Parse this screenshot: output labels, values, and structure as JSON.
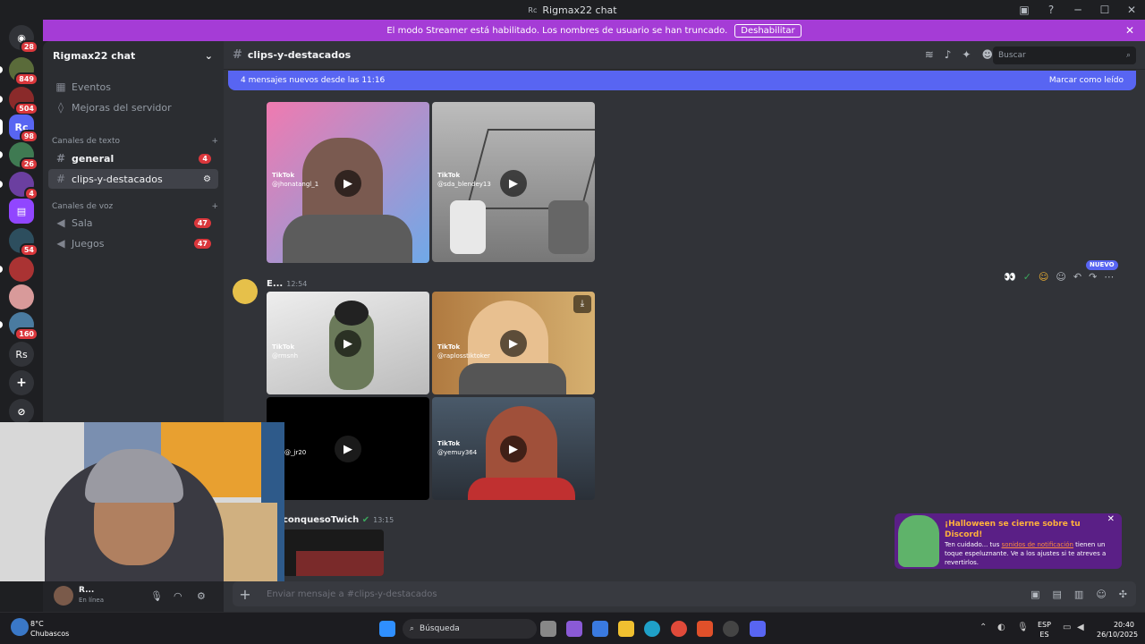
{
  "window": {
    "title": "Rigmax22 chat",
    "app_icon_text": "Rc"
  },
  "servers": {
    "badges": [
      "28",
      "849",
      "504",
      "98",
      "26",
      "4",
      "54",
      "160"
    ],
    "rs_label": "Rs",
    "active_label": "Rc"
  },
  "streamer_banner": {
    "text": "El modo Streamer está habilitado. Los nombres de usuario se han truncado.",
    "button": "Deshabilitar"
  },
  "sidebar": {
    "server_name": "Rigmax22 chat",
    "events": "Eventos",
    "boosts": "Mejoras del servidor",
    "text_category": "Canales de texto",
    "voice_category": "Canales de voz",
    "text_channels": [
      {
        "name": "general",
        "count": "4"
      },
      {
        "name": "clips-y-destacados"
      }
    ],
    "voice_channels": [
      {
        "name": "Sala",
        "count": "47"
      },
      {
        "name": "Juegos",
        "count": "47"
      }
    ]
  },
  "user_panel": {
    "name": "R...",
    "status": "En línea"
  },
  "channel_header": {
    "name": "clips-y-destacados",
    "search_placeholder": "Buscar"
  },
  "new_messages_bar": {
    "text": "4 mensajes nuevos desde las 11:16",
    "action": "Marcar como leído"
  },
  "messages": [
    {
      "author": "E...",
      "time": "12:54",
      "new_label": "NUEVO"
    },
    {
      "author": "conquesoTwich",
      "time": "13:15"
    }
  ],
  "tiktok": {
    "label": "TikTok",
    "handles": [
      "@jhonatangl_1",
      "@sda_blendey13",
      "@rmsnh",
      "@raplosstiktoker",
      "@_jr20",
      "@yemuy364"
    ]
  },
  "composer": {
    "placeholder": "Enviar mensaje a #clips-y-destacados"
  },
  "toast": {
    "title": "¡Halloween se cierne sobre tu Discord!",
    "body_pre": "Ten cuidado... tus ",
    "link": "sonidos de notificación",
    "body_post": " tienen un toque espeluznante. Ve a los ajustes si te atreves a revertirlos."
  },
  "taskbar": {
    "weather_temp": "8°C",
    "weather_desc": "Chubascos",
    "search": "Búsqueda",
    "lang1": "ESP",
    "lang2": "ES",
    "time": "20:40",
    "date": "26/10/2025"
  },
  "colors": {
    "accent": "#5865f2",
    "banner": "#a53cd6",
    "badge": "#da373c",
    "toast_title": "#ffb13b"
  }
}
